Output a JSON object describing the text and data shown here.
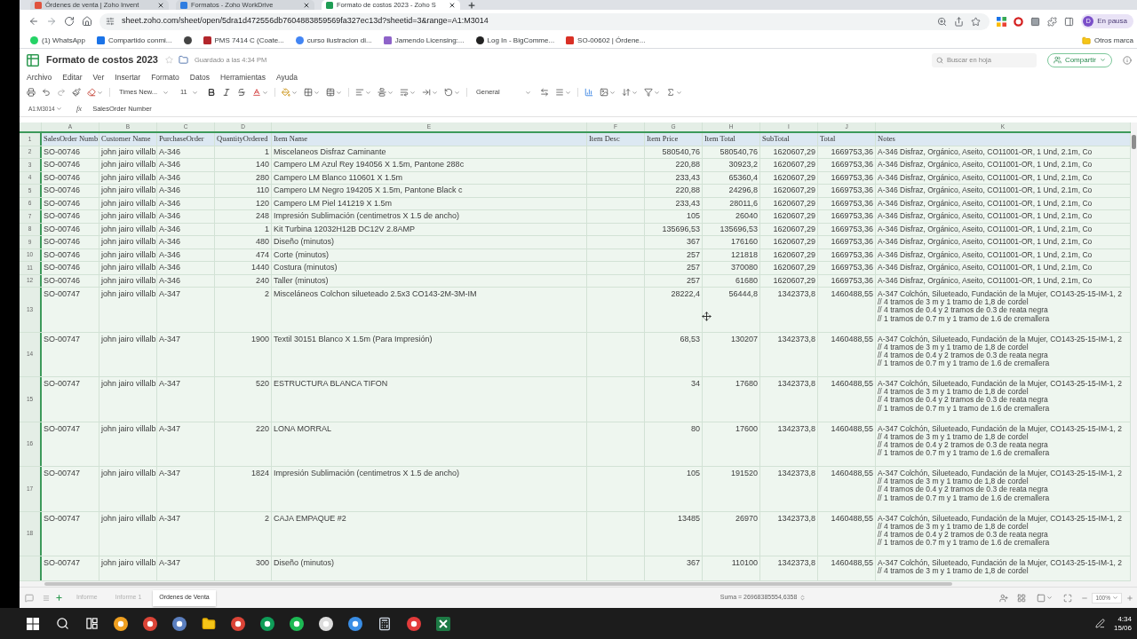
{
  "browser": {
    "tabs": [
      {
        "title": "Órdenes de venta | Zoho Invent",
        "selected": false
      },
      {
        "title": "Formatos - Zoho WorkDrive",
        "selected": false
      },
      {
        "title": "Formato de costos 2023 - Zoho S",
        "selected": true
      }
    ],
    "url": "sheet.zoho.com/sheet/open/5dra1d472556db7604883859569fa327ec13d?sheetid=3&range=A1:M3014",
    "profile": {
      "initial": "D",
      "status": "En pausa"
    },
    "bookmarks": [
      {
        "kind": "link",
        "label": "(1) WhatsApp"
      },
      {
        "kind": "link",
        "label": "Compartido conmi..."
      },
      {
        "kind": "icon"
      },
      {
        "kind": "link",
        "label": "PMS 7414 C (Coate..."
      },
      {
        "kind": "link",
        "label": "curso ilustracion di..."
      },
      {
        "kind": "link",
        "label": "Jamendo Licensing:..."
      },
      {
        "kind": "link",
        "label": "Log In - BigComme..."
      },
      {
        "kind": "link",
        "label": "SO-00602 | Órdene..."
      }
    ],
    "other_bookmarks": "Otros marca"
  },
  "document": {
    "title": "Formato de costos 2023",
    "saved_status": "Guardado a las 4:34 PM",
    "search_placeholder": "Buscar en hoja",
    "share_button": "Compartir"
  },
  "menu": [
    "Archivo",
    "Editar",
    "Ver",
    "Insertar",
    "Formato",
    "Datos",
    "Herramientas",
    "Ayuda"
  ],
  "toolbar": {
    "font": "Times New...",
    "font_size": "11",
    "number_format": "General"
  },
  "formula_bar": {
    "cell_reference": "A1:M3014",
    "fx": "fx",
    "value": "SalesOrder Number"
  },
  "sheet": {
    "columns": [
      "A",
      "B",
      "C",
      "D",
      "E",
      "F",
      "G",
      "H",
      "I",
      "J",
      "K"
    ],
    "rows": [
      {
        "number": "1",
        "kind": "header",
        "sales_order": "SalesOrder Numb",
        "customer": "Customer Name",
        "purchase_order": "PurchaseOrder",
        "quantity": "QuantityOrdered",
        "item_name": "Item Name",
        "item_desc": "Item Desc",
        "item_price": "Item Price",
        "item_total": "Item Total",
        "subtotal": "SubTotal",
        "total": "Total",
        "notes": "Notes"
      },
      {
        "number": "2",
        "kind": "line",
        "sales_order": "SO-00746",
        "customer": "john jairo villalb",
        "purchase_order": "A-346",
        "quantity": "1",
        "item_name": "Miscelaneos Disfraz Caminante",
        "item_price": "580540,76",
        "item_total": "580540,76",
        "subtotal": "1620607,29",
        "total": "1669753,36",
        "notes": "A-346 Disfraz, Orgánico, Aseito, CO11001-OR, 1 Und, 2.1m, Co"
      },
      {
        "number": "3",
        "kind": "line",
        "sales_order": "SO-00746",
        "customer": "john jairo villalb",
        "purchase_order": "A-346",
        "quantity": "140",
        "item_name": "Campero LM Azul Rey 194056 X 1.5m, Pantone 288c",
        "item_price": "220,88",
        "item_total": "30923,2",
        "subtotal": "1620607,29",
        "total": "1669753,36",
        "notes": "A-346 Disfraz, Orgánico, Aseito, CO11001-OR, 1 Und, 2.1m, Co"
      },
      {
        "number": "4",
        "kind": "line",
        "sales_order": "SO-00746",
        "customer": "john jairo villalb",
        "purchase_order": "A-346",
        "quantity": "280",
        "item_name": "Campero LM Blanco 110601 X 1.5m",
        "item_price": "233,43",
        "item_total": "65360,4",
        "subtotal": "1620607,29",
        "total": "1669753,36",
        "notes": "A-346 Disfraz, Orgánico, Aseito, CO11001-OR, 1 Und, 2.1m, Co"
      },
      {
        "number": "5",
        "kind": "line",
        "sales_order": "SO-00746",
        "customer": "john jairo villalb",
        "purchase_order": "A-346",
        "quantity": "110",
        "item_name": "Campero LM Negro 194205 X 1.5m, Pantone Black c",
        "item_price": "220,88",
        "item_total": "24296,8",
        "subtotal": "1620607,29",
        "total": "1669753,36",
        "notes": "A-346 Disfraz, Orgánico, Aseito, CO11001-OR, 1 Und, 2.1m, Co"
      },
      {
        "number": "6",
        "kind": "line",
        "sales_order": "SO-00746",
        "customer": "john jairo villalb",
        "purchase_order": "A-346",
        "quantity": "120",
        "item_name": "Campero LM Piel 141219 X 1.5m",
        "item_price": "233,43",
        "item_total": "28011,6",
        "subtotal": "1620607,29",
        "total": "1669753,36",
        "notes": "A-346 Disfraz, Orgánico, Aseito, CO11001-OR, 1 Und, 2.1m, Co"
      },
      {
        "number": "7",
        "kind": "line",
        "sales_order": "SO-00746",
        "customer": "john jairo villalb",
        "purchase_order": "A-346",
        "quantity": "248",
        "item_name": "Impresión Sublimación (centimetros X 1.5 de ancho)",
        "item_price": "105",
        "item_total": "26040",
        "subtotal": "1620607,29",
        "total": "1669753,36",
        "notes": "A-346 Disfraz, Orgánico, Aseito, CO11001-OR, 1 Und, 2.1m, Co"
      },
      {
        "number": "8",
        "kind": "line",
        "sales_order": "SO-00746",
        "customer": "john jairo villalb",
        "purchase_order": "A-346",
        "quantity": "1",
        "item_name": "Kit Turbina 12032H12B DC12V 2.8AMP",
        "item_price": "135696,53",
        "item_total": "135696,53",
        "subtotal": "1620607,29",
        "total": "1669753,36",
        "notes": "A-346 Disfraz, Orgánico, Aseito, CO11001-OR, 1 Und, 2.1m, Co"
      },
      {
        "number": "9",
        "kind": "line",
        "sales_order": "SO-00746",
        "customer": "john jairo villalb",
        "purchase_order": "A-346",
        "quantity": "480",
        "item_name": "Diseño (minutos)",
        "item_price": "367",
        "item_total": "176160",
        "subtotal": "1620607,29",
        "total": "1669753,36",
        "notes": "A-346 Disfraz, Orgánico, Aseito, CO11001-OR, 1 Und, 2.1m, Co"
      },
      {
        "number": "10",
        "kind": "line",
        "sales_order": "SO-00746",
        "customer": "john jairo villalb",
        "purchase_order": "A-346",
        "quantity": "474",
        "item_name": "Corte (minutos)",
        "item_price": "257",
        "item_total": "121818",
        "subtotal": "1620607,29",
        "total": "1669753,36",
        "notes": "A-346 Disfraz, Orgánico, Aseito, CO11001-OR, 1 Und, 2.1m, Co"
      },
      {
        "number": "11",
        "kind": "line",
        "sales_order": "SO-00746",
        "customer": "john jairo villalb",
        "purchase_order": "A-346",
        "quantity": "1440",
        "item_name": "Costura (minutos)",
        "item_price": "257",
        "item_total": "370080",
        "subtotal": "1620607,29",
        "total": "1669753,36",
        "notes": "A-346 Disfraz, Orgánico, Aseito, CO11001-OR, 1 Und, 2.1m, Co"
      },
      {
        "number": "12",
        "kind": "line",
        "sales_order": "SO-00746",
        "customer": "john jairo villalb",
        "purchase_order": "A-346",
        "quantity": "240",
        "item_name": "Taller (minutos)",
        "item_price": "257",
        "item_total": "61680",
        "subtotal": "1620607,29",
        "total": "1669753,36",
        "notes": "A-346 Disfraz, Orgánico, Aseito, CO11001-OR, 1 Und, 2.1m, Co"
      },
      {
        "number": "13",
        "kind": "wrapped",
        "sales_order": "SO-00747",
        "customer": "john jairo villalb",
        "purchase_order": "A-347",
        "quantity": "2",
        "item_name": "Misceláneos Colchon silueteado 2.5x3 CO143-2M-3M-IM",
        "item_price": "28222,4",
        "item_total": "56444,8",
        "subtotal": "1342373,8",
        "total": "1460488,55",
        "notes": "A-347 Colchón, Silueteado, Fundación de la Mujer, CO143-25-15-IM-1, 2\n// 4 tramos de 3 m y 1 tramo de 1,8 de cordel\n// 4 tramos de 0.4 y 2 tramos de 0.3 de reata negra\n// 1 tramos de 0.7 m y 1 tramo de 1.6 de cremallera"
      },
      {
        "number": "14",
        "kind": "wrapped",
        "sales_order": "SO-00747",
        "customer": "john jairo villalb",
        "purchase_order": "A-347",
        "quantity": "1900",
        "item_name": "Textil 30151 Blanco X 1.5m (Para Impresión)",
        "item_price": "68,53",
        "item_total": "130207",
        "subtotal": "1342373,8",
        "total": "1460488,55",
        "notes": "A-347 Colchón, Silueteado, Fundación de la Mujer, CO143-25-15-IM-1, 2\n// 4 tramos de 3 m y 1 tramo de 1,8 de cordel\n// 4 tramos de 0.4 y 2 tramos de 0.3 de reata negra\n// 1 tramos de 0.7 m y 1 tramo de 1.6 de cremallera"
      },
      {
        "number": "15",
        "kind": "wrapped",
        "sales_order": "SO-00747",
        "customer": "john jairo villalb",
        "purchase_order": "A-347",
        "quantity": "520",
        "item_name": "ESTRUCTURA BLANCA TIFON",
        "item_price": "34",
        "item_total": "17680",
        "subtotal": "1342373,8",
        "total": "1460488,55",
        "notes": "A-347 Colchón, Silueteado, Fundación de la Mujer, CO143-25-15-IM-1, 2\n// 4 tramos de 3 m y 1 tramo de 1,8 de cordel\n// 4 tramos de 0.4 y 2 tramos de 0.3 de reata negra\n// 1 tramos de 0.7 m y 1 tramo de 1.6 de cremallera"
      },
      {
        "number": "16",
        "kind": "wrapped",
        "sales_order": "SO-00747",
        "customer": "john jairo villalb",
        "purchase_order": "A-347",
        "quantity": "220",
        "item_name": "LONA MORRAL",
        "item_price": "80",
        "item_total": "17600",
        "subtotal": "1342373,8",
        "total": "1460488,55",
        "notes": "A-347 Colchón, Silueteado, Fundación de la Mujer, CO143-25-15-IM-1, 2\n// 4 tramos de 3 m y 1 tramo de 1,8 de cordel\n// 4 tramos de 0.4 y 2 tramos de 0.3 de reata negra\n// 1 tramos de 0.7 m y 1 tramo de 1.6 de cremallera"
      },
      {
        "number": "17",
        "kind": "wrapped",
        "sales_order": "SO-00747",
        "customer": "john jairo villalb",
        "purchase_order": "A-347",
        "quantity": "1824",
        "item_name": "Impresión Sublimación (centimetros X 1.5 de ancho)",
        "item_price": "105",
        "item_total": "191520",
        "subtotal": "1342373,8",
        "total": "1460488,55",
        "notes": "A-347 Colchón, Silueteado, Fundación de la Mujer, CO143-25-15-IM-1, 2\n// 4 tramos de 3 m y 1 tramo de 1,8 de cordel\n// 4 tramos de 0.4 y 2 tramos de 0.3 de reata negra\n// 1 tramos de 0.7 m y 1 tramo de 1.6 de cremallera"
      },
      {
        "number": "18",
        "kind": "wrapped",
        "sales_order": "SO-00747",
        "customer": "john jairo villalb",
        "purchase_order": "A-347",
        "quantity": "2",
        "item_name": "CAJA EMPAQUE #2",
        "item_price": "13485",
        "item_total": "26970",
        "subtotal": "1342373,8",
        "total": "1460488,55",
        "notes": "A-347 Colchón, Silueteado, Fundación de la Mujer, CO143-25-15-IM-1, 2\n// 4 tramos de 3 m y 1 tramo de 1,8 de cordel\n// 4 tramos de 0.4 y 2 tramos de 0.3 de reata negra\n// 1 tramos de 0.7 m y 1 tramo de 1.6 de cremallera"
      },
      {
        "kind": "wrapped",
        "sales_order": "SO-00747",
        "customer": "john jairo villalb",
        "purchase_order": "A-347",
        "quantity": "300",
        "item_name": "Diseño (minutos)",
        "item_price": "367",
        "item_total": "110100",
        "subtotal": "1342373,8",
        "total": "1460488,55",
        "notes": "A-347 Colchón, Silueteado, Fundación de la Mujer, CO143-25-15-IM-1, 2\n// 4 tramos de 3 m y 1 tramo de 1,8 de cordel"
      }
    ]
  },
  "sheet_tabs": [
    {
      "label": "Informe",
      "selected": false
    },
    {
      "label": "Informe 1",
      "selected": false
    },
    {
      "label": "Ordenes de Venta",
      "selected": true
    }
  ],
  "status_bar": {
    "sum": "Suma = 26968385554,6358",
    "zoom": "100%"
  },
  "taskbar": {
    "time": "4:34",
    "date": "15/06"
  }
}
